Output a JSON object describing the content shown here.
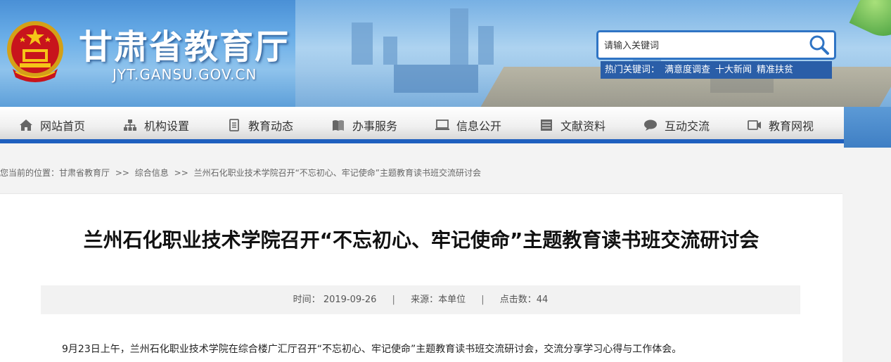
{
  "header": {
    "site_title": "甘肃省教育厅",
    "site_domain": "JYT.GANSU.GOV.CN",
    "search_placeholder": "请输入关键词",
    "hot_label": "热门关键词：",
    "hot_words": [
      "满意度调查",
      "十大新闻",
      "精准扶贫"
    ]
  },
  "nav": {
    "items": [
      {
        "label": "网站首页",
        "icon": "home-icon"
      },
      {
        "label": "机构设置",
        "icon": "org-chart-icon"
      },
      {
        "label": "教育动态",
        "icon": "document-icon"
      },
      {
        "label": "办事服务",
        "icon": "book-icon"
      },
      {
        "label": "信息公开",
        "icon": "monitor-icon"
      },
      {
        "label": "文献资料",
        "icon": "archive-icon"
      },
      {
        "label": "互动交流",
        "icon": "chat-icon"
      },
      {
        "label": "教育网视",
        "icon": "video-icon"
      }
    ]
  },
  "breadcrumb": {
    "prefix": "您当前的位置：",
    "items": [
      "甘肃省教育厅",
      "综合信息",
      "兰州石化职业技术学院召开“不忘初心、牢记使命”主题教育读书班交流研讨会"
    ],
    "separator": ">>"
  },
  "article": {
    "title": "兰州石化职业技术学院召开“不忘初心、牢记使命”主题教育读书班交流研讨会",
    "time_label": "时间：",
    "time_value": "2019-09-26",
    "source_label": "来源：",
    "source_value": "本单位",
    "views_label": "点击数：",
    "views_value": "44",
    "divider": "|",
    "body_first_line": "9月23日上午，兰州石化职业技术学院在综合楼广汇厅召开“不忘初心、牢记使命”主题教育读书班交流研讨会，交流分享学习心得与工作体会。"
  },
  "colors": {
    "nav_bottom_border": "#1f5fbf",
    "search_border": "#2f74c4",
    "hot_words_bg": "#2a5ea8"
  }
}
